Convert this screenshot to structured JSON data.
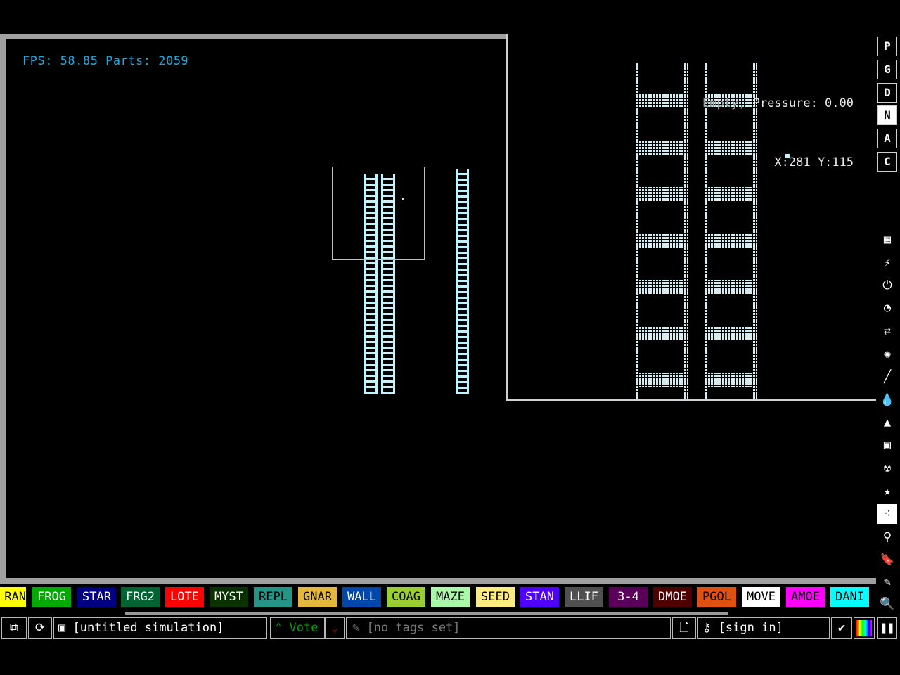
{
  "hud": {
    "fps_text": "FPS: 58.85 Parts: 2059",
    "hover_element": "Empty,",
    "pressure": "Pressure: 0.00",
    "coords": "X:281 Y:115"
  },
  "menu_sections": [
    "P",
    "G",
    "D",
    "N",
    "A",
    "C"
  ],
  "active_section": "N",
  "tool_categories": [
    {
      "icon": "walls-icon"
    },
    {
      "icon": "electronics-icon"
    },
    {
      "icon": "powered-icon"
    },
    {
      "icon": "sensors-icon"
    },
    {
      "icon": "force-icon"
    },
    {
      "icon": "explosives-icon"
    },
    {
      "icon": "gases-icon"
    },
    {
      "icon": "liquids-icon"
    },
    {
      "icon": "powders-icon"
    },
    {
      "icon": "solids-icon"
    },
    {
      "icon": "radioactive-icon"
    },
    {
      "icon": "special-icon"
    },
    {
      "icon": "life-icon"
    },
    {
      "icon": "tools-icon"
    },
    {
      "icon": "favorites-icon"
    },
    {
      "icon": "decoration-icon"
    },
    {
      "icon": "search-icon"
    }
  ],
  "elements": [
    {
      "label": "RAN",
      "bg": "#ffff00",
      "fg": "#000000"
    },
    {
      "label": "FROG",
      "bg": "#00aa00",
      "fg": "#ffffff"
    },
    {
      "label": "STAR",
      "bg": "#000080",
      "fg": "#ffffff"
    },
    {
      "label": "FRG2",
      "bg": "#006432",
      "fg": "#ffffff"
    },
    {
      "label": "LOTE",
      "bg": "#ff0000",
      "fg": "#ffffff"
    },
    {
      "label": "MYST",
      "bg": "#0a3200",
      "fg": "#ffffff"
    },
    {
      "label": "REPL",
      "bg": "#259588",
      "fg": "#000000"
    },
    {
      "label": "GNAR",
      "bg": "#e5b73b",
      "fg": "#000000"
    },
    {
      "label": "WALL",
      "bg": "#0047ab",
      "fg": "#ffffff"
    },
    {
      "label": "COAG",
      "bg": "#9acd32",
      "fg": "#000000"
    },
    {
      "label": "MAZE",
      "bg": "#a9f7a8",
      "fg": "#000000"
    },
    {
      "label": "SEED",
      "bg": "#fbec7d",
      "fg": "#000000"
    },
    {
      "label": "STAN",
      "bg": "#5000ff",
      "fg": "#ffffff"
    },
    {
      "label": "LLIF",
      "bg": "#505050",
      "fg": "#ffffff"
    },
    {
      "label": "3-4",
      "bg": "#5a005a",
      "fg": "#ffffff"
    },
    {
      "label": "DMOE",
      "bg": "#500000",
      "fg": "#ffffff"
    },
    {
      "label": "PGOL",
      "bg": "#e05010",
      "fg": "#000000"
    },
    {
      "label": "MOVE",
      "bg": "#ffffff",
      "fg": "#000000"
    },
    {
      "label": "AMOE",
      "bg": "#ff00ff",
      "fg": "#000000"
    },
    {
      "label": "DANI",
      "bg": "#00ffff",
      "fg": "#000000"
    }
  ],
  "bottom": {
    "save_title": "[untitled simulation]",
    "vote_label": "Vote",
    "tags_text": "[no tags set]",
    "signin_text": "[sign in]"
  },
  "colors": {
    "particle": "#bff4ff",
    "fps": "#20a8e0",
    "vote_up": "#00a000",
    "vote_down": "#a00000"
  }
}
